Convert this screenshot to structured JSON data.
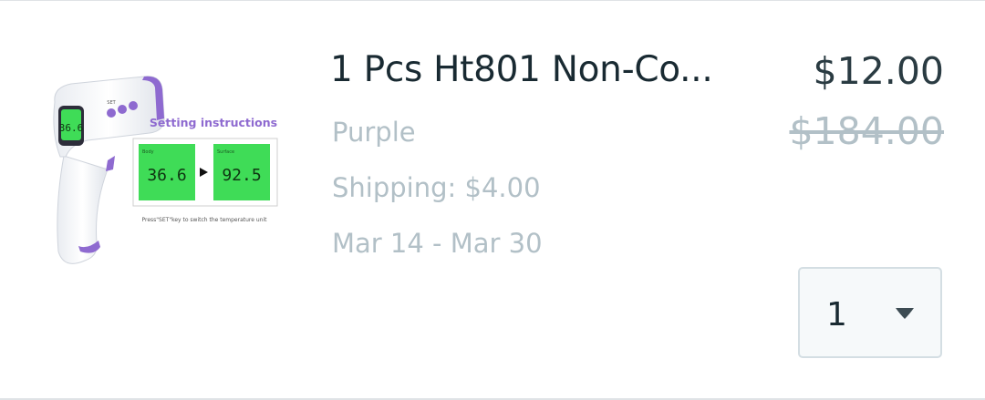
{
  "product": {
    "title": "1 Pcs Ht801 Non-Co...",
    "variant": "Purple",
    "shipping": "Shipping: $4.00",
    "delivery": "Mar 14 - Mar 30",
    "price": "$12.00",
    "original_price": "$184.00",
    "image": {
      "heading": "Setting instructions",
      "reading_body": "36.6",
      "reading_surface": "92.5",
      "panel_label_left": "Body",
      "panel_label_right": "Surface",
      "caption": "Press\"SET\"key to switch the temperature unit",
      "device_display": "36.6",
      "device_set": "SET"
    }
  },
  "quantity": {
    "value": "1",
    "icon": "chevron-down-icon"
  },
  "colors": {
    "title": "#192a32",
    "muted": "#b2c0c7",
    "lcd_green": "#3fdc57",
    "accent_purple": "#8e6ad0"
  }
}
